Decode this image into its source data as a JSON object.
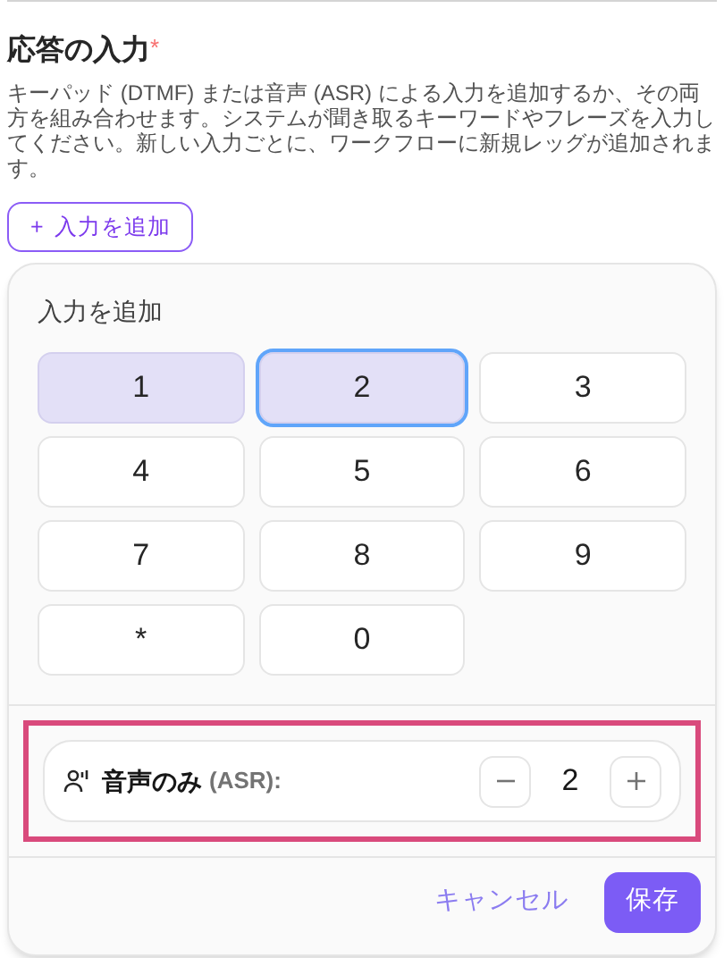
{
  "section": {
    "title": "応答の入力",
    "required_mark": "*",
    "description": "キーパッド (DTMF) または音声 (ASR) による入力を追加するか、その両方を組み合わせます。システムが聞き取るキーワードやフレーズを入力してください。新しい入力ごとに、ワークフローに新規レッグが追加されます。",
    "add_button": {
      "icon": "+",
      "label": "入力を追加"
    }
  },
  "popover": {
    "title": "入力を追加",
    "keys": [
      {
        "label": "1",
        "selected": true,
        "focused": false
      },
      {
        "label": "2",
        "selected": true,
        "focused": true
      },
      {
        "label": "3",
        "selected": false,
        "focused": false
      },
      {
        "label": "4",
        "selected": false,
        "focused": false
      },
      {
        "label": "5",
        "selected": false,
        "focused": false
      },
      {
        "label": "6",
        "selected": false,
        "focused": false
      },
      {
        "label": "7",
        "selected": false,
        "focused": false
      },
      {
        "label": "8",
        "selected": false,
        "focused": false
      },
      {
        "label": "9",
        "selected": false,
        "focused": false
      },
      {
        "label": "*",
        "selected": false,
        "focused": false
      },
      {
        "label": "0",
        "selected": false,
        "focused": false
      }
    ],
    "asr": {
      "label": "音声のみ",
      "sublabel": "(ASR):",
      "value": "2",
      "highlighted": true
    },
    "cancel": "キャンセル",
    "save": "保存"
  }
}
